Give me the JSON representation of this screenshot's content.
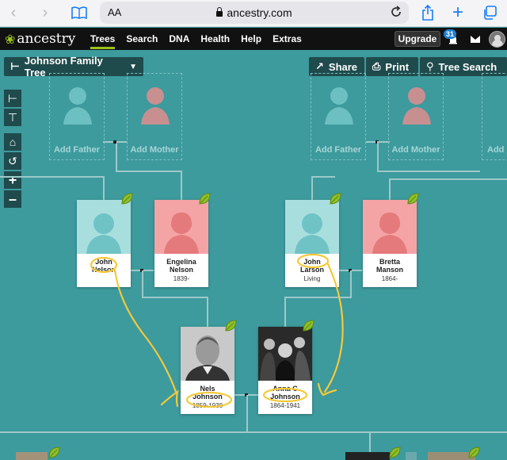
{
  "browser": {
    "aa_label": "AA",
    "url": "ancestry.com"
  },
  "nav": {
    "logo": "ancestry",
    "links": [
      "Trees",
      "Search",
      "DNA",
      "Health",
      "Help",
      "Extras"
    ],
    "active": "Trees",
    "upgrade": "Upgrade",
    "notification_count": "31"
  },
  "tree": {
    "name": "Johnson Family Tree",
    "share": "Share",
    "print": "Print",
    "search": "Tree Search"
  },
  "placeholders": {
    "add_father": "Add Father",
    "add_mother": "Add Mother",
    "add_partial": "Add F"
  },
  "people": {
    "john_nelson": {
      "name1": "John",
      "name2": "Nelson",
      "years": ""
    },
    "engelina_nelson": {
      "name1": "Engelina",
      "name2": "Nelson",
      "years": "1839-"
    },
    "john_larson": {
      "name1": "John",
      "name2": "Larson",
      "years": "Living"
    },
    "bretta_manson": {
      "name1": "Bretta",
      "name2": "Manson",
      "years": "1864-"
    },
    "nels_johnson": {
      "name1": "Nels",
      "name2": "Johnson",
      "years": "1859-1938"
    },
    "anna_johnson": {
      "name1": "Anna C",
      "name2": "Johnson",
      "years": "1864-1941"
    }
  },
  "colors": {
    "background": "#3d9a9d",
    "male": "#a9dedf",
    "female": "#f4a4a5",
    "hint_leaf": "#8fbf2a",
    "annotation": "#f5c93a"
  }
}
